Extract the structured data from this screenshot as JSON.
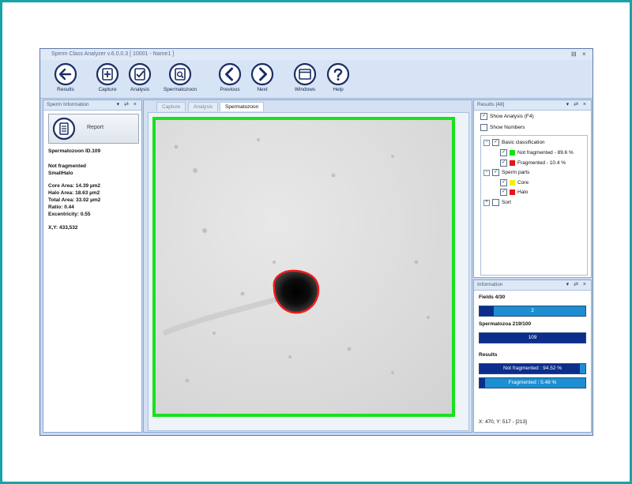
{
  "window": {
    "title": "Sperm Class Analyzer v.6.0.0.3  [ 10001 - Name1 ]",
    "controls": [
      "⊟",
      "×"
    ]
  },
  "ribbon": {
    "buttons": [
      {
        "label": "Results",
        "icon": "arrow-left-icon"
      },
      {
        "label": "Capture",
        "icon": "capture-icon"
      },
      {
        "label": "Analysis",
        "icon": "analysis-icon"
      },
      {
        "label": "Spermatozoon",
        "icon": "spermatozoon-icon"
      },
      {
        "label": "Previous",
        "icon": "chevron-left-icon"
      },
      {
        "label": "Next",
        "icon": "chevron-right-icon"
      },
      {
        "label": "Windows",
        "icon": "windows-icon"
      },
      {
        "label": "Help",
        "icon": "help-icon"
      }
    ]
  },
  "sperm_info": {
    "title": "Sperm Information",
    "panel_controls": "▾ ⇄ ×",
    "report_label": "Report",
    "id": "Spermatozoon ID.109",
    "status": "Not fragmented",
    "halo_class": "SmallHalo",
    "core_area": "Core Area: 14.39  µm2",
    "halo_area": "Halo Area: 18.63  µm2",
    "total_area": "Total  Area: 33.02  µm2",
    "ratio": "Ratio: 0.44",
    "excentricity": "Excentricity:  0.55",
    "xy": "X,Y: 433,532"
  },
  "center": {
    "tabs": [
      {
        "label": "Capture",
        "active": false
      },
      {
        "label": "Analysis",
        "active": false
      },
      {
        "label": "Spermatozoon",
        "active": true
      }
    ]
  },
  "results_panel": {
    "title": "Results [48]",
    "panel_controls": "▾ ⇄ ×",
    "show_analysis": "Show Analysis (F4)",
    "show_numbers": "Show Numbers",
    "basic_classification": "Basic classification",
    "not_fragmented": "Not fragmented - 89.6 %",
    "fragmented": "Fragmented - 10.4 %",
    "sperm_parts": "Sperm parts",
    "core": "Core",
    "halo": "Halo",
    "sort": "Sort",
    "colors": {
      "not_fragmented": "#14e014",
      "fragmented": "#e81414",
      "core": "#f2ef18",
      "halo": "#e81414"
    }
  },
  "information": {
    "title": "Information",
    "panel_controls": "▾ ⇄ ×",
    "fields_label": "Fields 4/30",
    "fields_value": "2",
    "fields_fraction": 0.133,
    "spermatozoa_label": "Spermatozoa 219/100",
    "spermatozoa_value": "109",
    "spermatozoa_fraction": 1.0,
    "results_label": "Results",
    "not_fragmented_bar": "Not fragmented : 94.52 %",
    "not_fragmented_fraction": 0.9452,
    "fragmented_bar": "Fragmented : 5.48 %",
    "fragmented_fraction": 0.0548,
    "coords": "X: 470, Y: 517 - [213]"
  }
}
